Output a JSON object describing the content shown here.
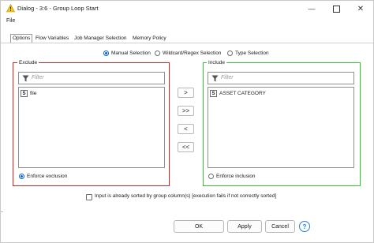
{
  "window": {
    "title": "Dialog - 3:6 - Group Loop Start",
    "icon": "warning-triangle-icon",
    "controls": [
      "minimize-icon",
      "maximize-icon",
      "close-icon"
    ]
  },
  "menubar": {
    "file": "File"
  },
  "tabs": [
    {
      "label": "Options",
      "active": true
    },
    {
      "label": "Flow Variables",
      "active": false
    },
    {
      "label": "Job Manager Selection",
      "active": false
    },
    {
      "label": "Memory Policy",
      "active": false
    }
  ],
  "selection_mode": {
    "options": [
      "Manual Selection",
      "Wildcard/Regex Selection",
      "Type Selection"
    ],
    "selected": "Manual Selection"
  },
  "exclude": {
    "title": "Exclude",
    "filter_placeholder": "Filter",
    "items": [
      {
        "type_badge": "S",
        "name": "file"
      }
    ],
    "enforce_label": "Enforce exclusion",
    "enforce_selected": true
  },
  "include": {
    "title": "Include",
    "filter_placeholder": "Filter",
    "items": [
      {
        "type_badge": "S",
        "name": "ASSET CATEGORY"
      }
    ],
    "enforce_label": "Enforce inclusion",
    "enforce_selected": false
  },
  "move_buttons": [
    ">",
    ">>",
    "<",
    "<<"
  ],
  "sorted_checkbox": {
    "label": "Input is already sorted by group column(s) [execution fails if not correctly sorted]",
    "checked": false
  },
  "buttons": {
    "ok": "OK",
    "apply": "Apply",
    "cancel": "Cancel",
    "help": "?"
  },
  "colors": {
    "exclude_border": "#d32222",
    "include_border": "#2ec72e",
    "accent": "#0a64c8"
  }
}
